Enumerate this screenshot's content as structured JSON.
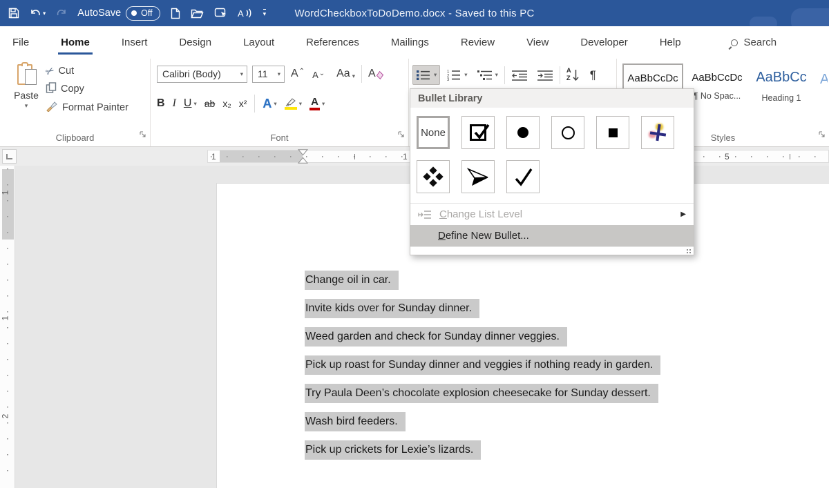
{
  "titlebar": {
    "title": "WordCheckboxToDoDemo.docx  -  Saved to this PC",
    "autosave_label": "AutoSave",
    "autosave_state": "Off"
  },
  "tabs": {
    "file": "File",
    "home": "Home",
    "insert": "Insert",
    "design": "Design",
    "layout": "Layout",
    "references": "References",
    "mailings": "Mailings",
    "review": "Review",
    "view": "View",
    "developer": "Developer",
    "help": "Help",
    "search": "Search"
  },
  "ribbon": {
    "clipboard": {
      "group_label": "Clipboard",
      "paste": "Paste",
      "cut": "Cut",
      "copy": "Copy",
      "format_painter": "Format Painter"
    },
    "font": {
      "group_label": "Font",
      "font_name": "Calibri (Body)",
      "font_size": "11",
      "bold": "B",
      "italic": "I",
      "underline": "U",
      "strikethrough": "ab",
      "subscript": "x₂",
      "superscript": "x²",
      "grow_font": "A",
      "shrink_font": "A",
      "change_case": "Aa",
      "clear_formatting": "A",
      "text_effects": "A",
      "font_color": "A"
    },
    "paragraph": {
      "sort_a": "A",
      "sort_z": "Z",
      "pilcrow": "¶"
    },
    "styles": {
      "group_label": "Styles",
      "items": [
        {
          "preview": "AaBbCcDc",
          "name": ""
        },
        {
          "preview": "AaBbCcDc",
          "name": "¶ No Spac..."
        },
        {
          "preview": "AaBbCc",
          "name": "Heading 1"
        },
        {
          "preview": "A",
          "name": ""
        }
      ]
    }
  },
  "bullet_menu": {
    "header": "Bullet Library",
    "none_label": "None",
    "cells": [
      "none",
      "checked-checkbox",
      "filled-circle",
      "open-circle",
      "filled-square",
      "colored-star",
      "four-diamonds",
      "arrow",
      "checkmark"
    ],
    "change_list_level": {
      "accel": "C",
      "rest": "hange List Level"
    },
    "define_new_bullet": {
      "accel": "D",
      "rest": "efine New Bullet..."
    }
  },
  "ruler": {
    "h_labels": [
      "1",
      "1",
      "5"
    ],
    "v_labels": [
      "1",
      "1",
      "2"
    ]
  },
  "document": {
    "lines": [
      "Change oil in car.",
      "Invite kids over for Sunday dinner.",
      "Weed garden and check for Sunday dinner veggies.",
      "Pick up roast for Sunday dinner and veggies if nothing ready in garden.",
      "Try Paula Deen’s chocolate explosion cheesecake for Sunday dessert.",
      "Wash bird feeders.",
      "Pick up crickets for Lexie’s lizards."
    ]
  },
  "colors": {
    "titlebar": "#2b579a",
    "accent": "#2b579a",
    "selection_highlight": "#cacaca",
    "heading_style": "#2e5f9e",
    "font_color_bar": "#c00000",
    "highlight_bar": "#ffe60a"
  }
}
